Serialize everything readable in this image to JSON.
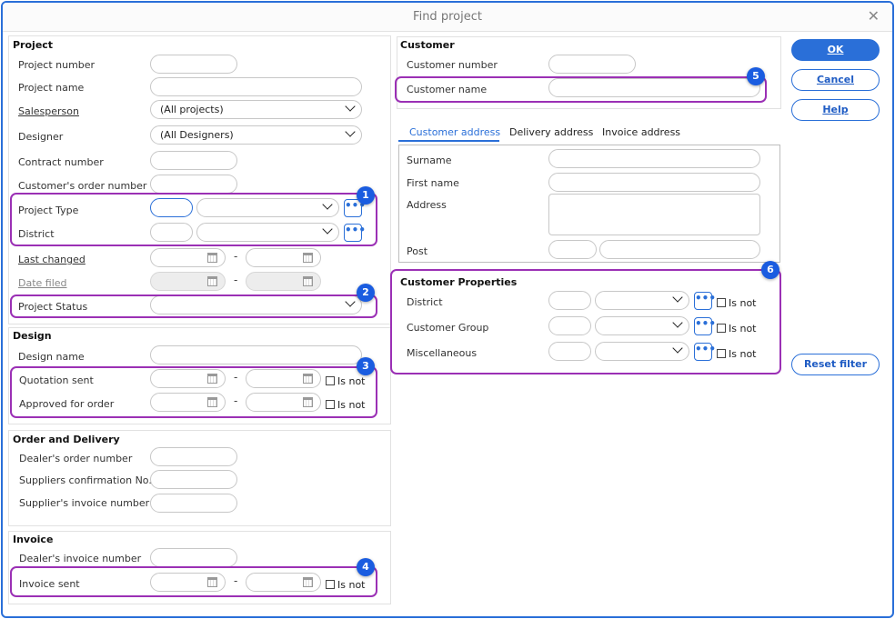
{
  "window": {
    "title": "Find project"
  },
  "buttons": {
    "ok": "OK",
    "cancel": "Cancel",
    "help": "Help",
    "reset": "Reset filter"
  },
  "project": {
    "heading": "Project",
    "project_number": "Project number",
    "project_name": "Project name",
    "salesperson": "Salesperson",
    "salesperson_value": "(All projects)",
    "designer": "Designer",
    "designer_value": "(All Designers)",
    "contract_number": "Contract number",
    "customer_order_number": "Customer's order number",
    "project_type": "Project Type",
    "district": "District",
    "last_changed": "Last changed",
    "date_filed": "Date filed",
    "project_status": "Project Status"
  },
  "design": {
    "heading": "Design",
    "design_name": "Design name",
    "quotation_sent": "Quotation sent",
    "approved_for_order": "Approved for order"
  },
  "order_delivery": {
    "heading": "Order and Delivery",
    "dealer_order_number": "Dealer's order number",
    "suppliers_confirmation": "Suppliers confirmation No.",
    "supplier_invoice_number": "Supplier's invoice number"
  },
  "invoice": {
    "heading": "Invoice",
    "dealer_invoice_number": "Dealer's invoice number",
    "invoice_sent": "Invoice sent"
  },
  "customer": {
    "heading": "Customer",
    "customer_number": "Customer number",
    "customer_name": "Customer name"
  },
  "tabs": [
    "Customer address",
    "Delivery address",
    "Invoice address"
  ],
  "address": {
    "surname": "Surname",
    "first_name": "First name",
    "address": "Address",
    "post": "Post"
  },
  "properties": {
    "heading": "Customer Properties",
    "district": "District",
    "customer_group": "Customer Group",
    "miscellaneous": "Miscellaneous"
  },
  "common": {
    "is_not": "Is not",
    "dash": "-",
    "dots": "•••"
  },
  "badges": [
    "1",
    "2",
    "3",
    "4",
    "5",
    "6"
  ],
  "colors": {
    "accent": "#2a6fd8",
    "highlight": "#9b30b5",
    "badge": "#1a5ce0"
  }
}
